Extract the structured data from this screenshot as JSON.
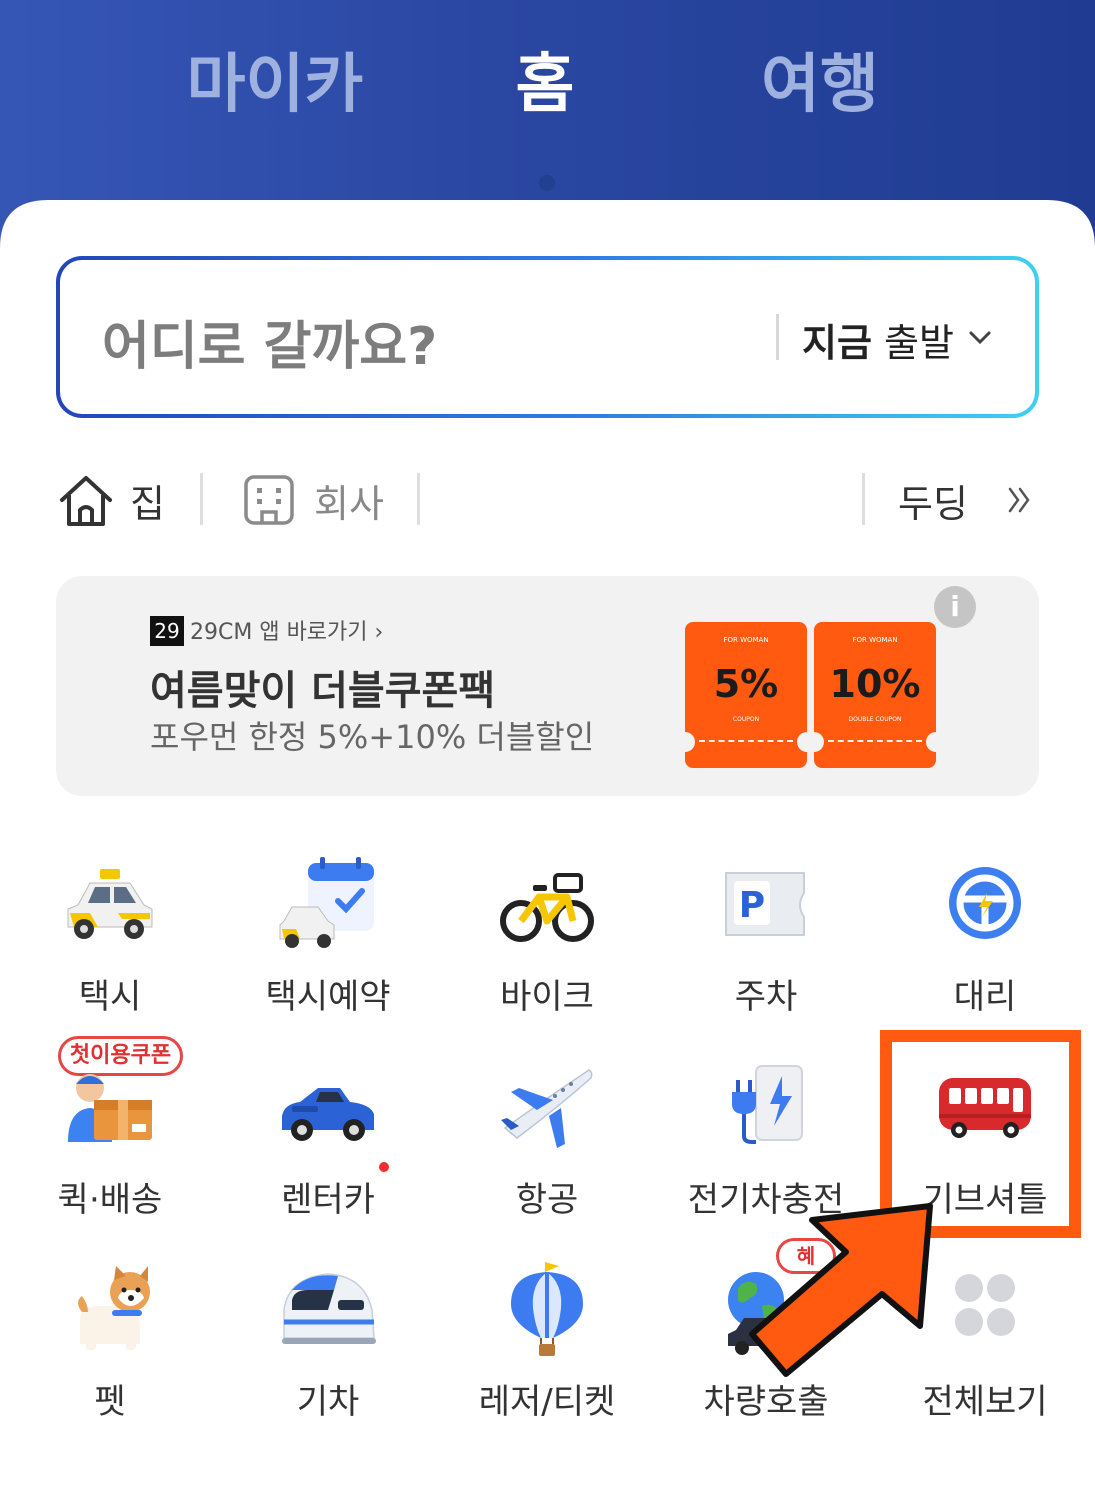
{
  "tabs": [
    {
      "label": "마이카"
    },
    {
      "label": "홈"
    },
    {
      "label": "여행"
    }
  ],
  "search": {
    "placeholder": "어디로 갈까요?",
    "depart_bold": "지금",
    "depart_rest": " 출발"
  },
  "quick": {
    "home": "집",
    "work": "회사",
    "recent": "두딩"
  },
  "banner": {
    "brand_badge": "29",
    "brand_link": "29CM 앱 바로가기 ›",
    "title": "여름맞이 더블쿠폰팩",
    "subtitle": "포우먼 한정 5%+10% 더블할인",
    "coupon1": {
      "top": "FOR WOMAN",
      "value": "5%",
      "bottom": "COUPON"
    },
    "coupon2": {
      "top": "FOR WOMAN",
      "value": "10%",
      "bottom": "DOUBLE COUPON"
    },
    "info": "i"
  },
  "services": {
    "taxi": "택시",
    "taxi_reserve": "택시예약",
    "bike": "바이크",
    "parking": "주차",
    "driver": "대리",
    "quick_delivery": "퀵·배송",
    "rentcar": "렌터카",
    "flight": "항공",
    "ev_charge": "전기차충전",
    "shuttle": "기브셔틀",
    "pet": "펫",
    "train": "기차",
    "leisure": "레저/티켓",
    "car_call": "차량호출",
    "all": "전체보기"
  },
  "badges": {
    "first_coupon": "첫이용쿠폰",
    "event": "혜"
  },
  "colors": {
    "header_blue": "#2a47a2",
    "highlight_orange": "#ff5a0f",
    "coupon_orange": "#ff5a0f"
  }
}
